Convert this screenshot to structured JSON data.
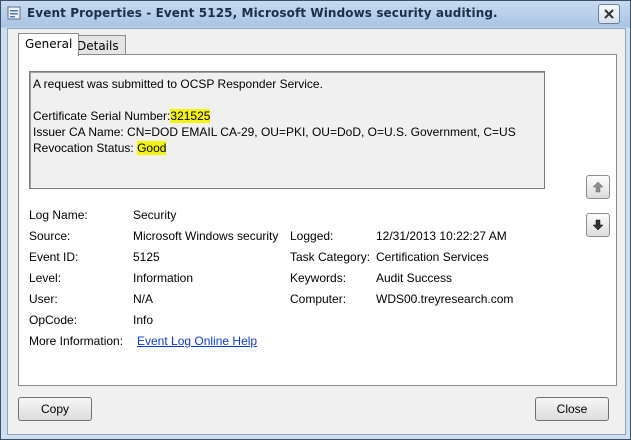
{
  "window": {
    "title": "Event Properties - Event 5125, Microsoft Windows security auditing.",
    "close_label": "×"
  },
  "tabs": [
    {
      "label": "General",
      "active": true
    },
    {
      "label": "Details",
      "active": false
    }
  ],
  "description": {
    "line1": "A request was submitted to OCSP Responder Service.",
    "serial_label": "Certificate Serial Number:",
    "serial_value": "321525",
    "issuer": "Issuer CA Name: CN=DOD EMAIL CA-29, OU=PKI, OU=DoD, O=U.S. Government, C=US",
    "revocation_label": "Revocation Status:",
    "revocation_value": "Good",
    "highlight_color": "#f4f40a"
  },
  "fields": {
    "log_name": {
      "label": "Log Name:",
      "value": "Security"
    },
    "source": {
      "label": "Source:",
      "value": "Microsoft Windows security"
    },
    "logged": {
      "label": "Logged:",
      "value": "12/31/2013 10:22:27 AM"
    },
    "event_id": {
      "label": "Event ID:",
      "value": "5125"
    },
    "task_category": {
      "label": "Task Category:",
      "value": "Certification Services"
    },
    "level": {
      "label": "Level:",
      "value": "Information"
    },
    "keywords": {
      "label": "Keywords:",
      "value": "Audit Success"
    },
    "user": {
      "label": "User:",
      "value": "N/A"
    },
    "computer": {
      "label": "Computer:",
      "value": "WDS00.treyresearch.com"
    },
    "opcode": {
      "label": "OpCode:",
      "value": "Info"
    },
    "more_info": {
      "label": "More Information:",
      "value": "Event Log Online Help"
    }
  },
  "buttons": {
    "copy": "Copy",
    "close": "Close"
  },
  "icons": {
    "up": "arrow-up-icon",
    "down": "arrow-down-icon"
  }
}
